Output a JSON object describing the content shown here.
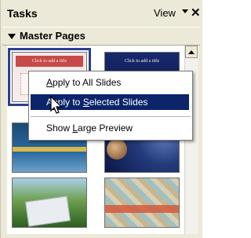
{
  "titlebar": {
    "title": "Tasks",
    "view_label": "View",
    "close_symbol": "✕"
  },
  "section": {
    "label": "Master Pages",
    "expand_icon": "triangle-down-icon"
  },
  "thumbnails": [
    {
      "title": "Click to add a title",
      "selected": true
    },
    {
      "title": "Click to add a title",
      "selected": false
    },
    {
      "title": "",
      "selected": false
    },
    {
      "title": "",
      "selected": false
    },
    {
      "title": "",
      "selected": false
    },
    {
      "title": "",
      "selected": false
    }
  ],
  "context_menu": {
    "items": [
      {
        "prefix": "",
        "mnemonic": "A",
        "rest": "pply to All Slides"
      },
      {
        "prefix": "Apply to ",
        "mnemonic": "S",
        "rest": "elected Slides"
      },
      {
        "prefix": "Show ",
        "mnemonic": "L",
        "rest": "arge Preview"
      }
    ],
    "highlighted_index": 1
  },
  "colors": {
    "selection_highlight": "#0b246a",
    "panel_background": "#ece9d8"
  }
}
